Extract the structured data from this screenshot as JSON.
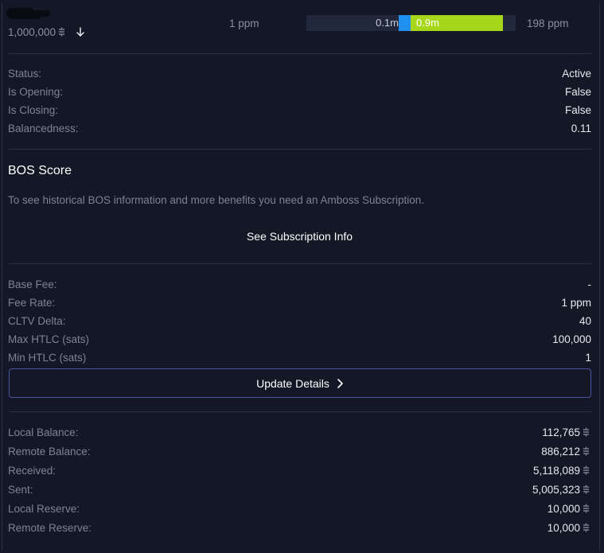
{
  "channel": {
    "capacity": "1,000,000",
    "capacity_unit_icon": "sats-icon",
    "direction_icon": "arrow-down-icon",
    "fee_left": "1 ppm",
    "fee_right": "198 ppm",
    "liquidity": {
      "local_label": "0.1m",
      "remote_label": "0.9m",
      "local_fraction": 0.11,
      "remote_fraction": 0.89,
      "colors": {
        "local": "#1f8ff0",
        "remote": "#a7d71b",
        "track": "#22283b"
      }
    }
  },
  "status_rows": [
    {
      "label": "Status:",
      "value": "Active"
    },
    {
      "label": "Is Opening:",
      "value": "False"
    },
    {
      "label": "Is Closing:",
      "value": "False"
    },
    {
      "label": "Balancedness:",
      "value": "0.11"
    }
  ],
  "bos": {
    "title": "BOS Score",
    "description": "To see historical BOS information and more benefits you need an Amboss Subscription.",
    "link_label": "See Subscription Info"
  },
  "policy_rows": [
    {
      "label": "Base Fee:",
      "value": "-"
    },
    {
      "label": "Fee Rate:",
      "value": "1 ppm"
    },
    {
      "label": "CLTV Delta:",
      "value": "40"
    },
    {
      "label": "Max HTLC (sats)",
      "value": "100,000"
    },
    {
      "label": "Min HTLC (sats)",
      "value": "1"
    }
  ],
  "update_button": {
    "label": "Update Details",
    "icon": "chevron-right-icon"
  },
  "balance_rows": [
    {
      "label": "Local Balance:",
      "value": "112,765"
    },
    {
      "label": "Remote Balance:",
      "value": "886,212"
    },
    {
      "label": "Received:",
      "value": "5,118,089"
    },
    {
      "label": "Sent:",
      "value": "5,005,323"
    },
    {
      "label": "Local Reserve:",
      "value": "10,000"
    },
    {
      "label": "Remote Reserve:",
      "value": "10,000"
    }
  ],
  "colors": {
    "background": "#141726",
    "accent_border": "#4a55a3",
    "muted_text": "#7d8297"
  }
}
